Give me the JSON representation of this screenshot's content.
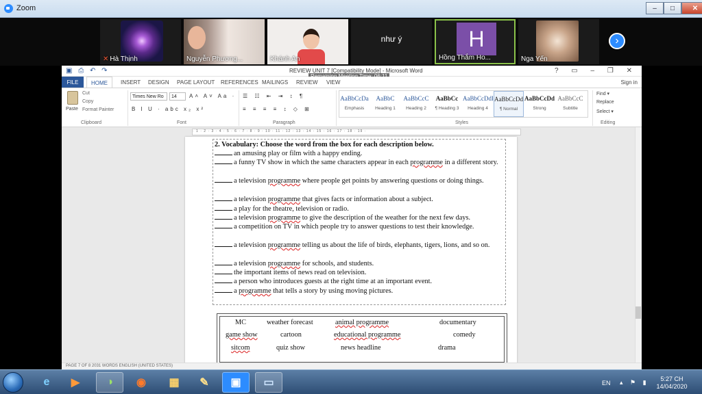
{
  "zoom": {
    "title": "Zoom",
    "window_buttons": [
      "–",
      "□",
      "✕"
    ],
    "participants": [
      {
        "name": "Hà Thịnh",
        "muted": true
      },
      {
        "name": "Nguyễn Phương...",
        "muted": false
      },
      {
        "name": "Khánh An",
        "muted": false
      },
      {
        "name": "như ý",
        "muted": false
      },
      {
        "name": "Hồng Thắm Ho...",
        "avatar_letter": "H",
        "active_speaker": true,
        "muted": false
      },
      {
        "name": "Nga Yến",
        "muted": false
      }
    ],
    "next_arrow": "›"
  },
  "word": {
    "quick_access": "▣ ⎙ ↶ ↷",
    "document_title": "REVIEW UNIT 7 [Compatibility Mode] - Microsoft Word",
    "meeting_time": "Remaining Meeting Time: 06:11",
    "title_controls": "? ▭ – ❐ ✕",
    "tabs": [
      "FILE",
      "HOME",
      "INSERT",
      "DESIGN",
      "PAGE LAYOUT",
      "REFERENCES",
      "MAILINGS",
      "REVIEW",
      "VIEW"
    ],
    "signin": "Sign in",
    "ribbon": {
      "paste": "Paste",
      "cut": "Cut",
      "copy": "Copy",
      "format_painter": "Format Painter",
      "clipboard": "Clipboard",
      "font_name": "Times New Ro",
      "font_size": "14",
      "font_btns": "B I U · abc x₂ x²",
      "font_btns2": "A˄ A˅ Aa ·",
      "font": "Font",
      "para_btns": "☰ ☷ ⇤ ⇥ ↕ ¶",
      "para_btns2": "≡ ≡ ≡ ≡ ↕ ◇ ⊞",
      "paragraph": "Paragraph",
      "styles": [
        {
          "sample": "AaBbCcDa",
          "name": "Emphasis"
        },
        {
          "sample": "AaBbC",
          "name": "Heading 1"
        },
        {
          "sample": "AaBbCcC",
          "name": "Heading 2"
        },
        {
          "sample": "AaBbCc",
          "name": "¶ Heading 3"
        },
        {
          "sample": "AaBbCcDdI",
          "name": "Heading 4"
        },
        {
          "sample": "AaBbCcDdI",
          "name": "¶ Normal"
        },
        {
          "sample": "AaBbCcDd",
          "name": "Strong"
        },
        {
          "sample": "AaBbCcC",
          "name": "Subtitle"
        }
      ],
      "styles_label": "Styles",
      "find": "Find ▾",
      "replace": "Replace",
      "select": "Select ▾",
      "editing": "Editing"
    },
    "ruler": "· 1 · 2 · 3 · 4 · 5 · 6 · 7 · 8 · 9 · 10 · 11 · 12 · 13 · 14 · 15 · 16 · 17 · 18 · 19 ·",
    "doc": {
      "heading": "2. Vocabulary: Choose the word from the box for each description below.",
      "items": [
        {
          "pre": "",
          "squig": "",
          "text": "an amusing play or film with a happy ending."
        },
        {
          "pre": "a funny TV show in which the same characters appear in each ",
          "squig": "programme",
          "text": " in a different story."
        },
        {
          "pre": "a television ",
          "squig": "programme",
          "text": " where people get points by answering questions or doing things."
        },
        {
          "pre": "a television ",
          "squig": "programme",
          "text": " that gives facts or information about a subject."
        },
        {
          "pre": "",
          "squig": "",
          "text": "a play for the theatre, television or radio."
        },
        {
          "pre": "a television ",
          "squig": "programme",
          "text": " to give the description of the weather for the next few days."
        },
        {
          "pre": "",
          "squig": "",
          "text": "a competition on TV in which people try to answer questions to test their knowledge."
        },
        {
          "pre": "a television ",
          "squig": "programme",
          "text": " telling us about the life of birds, elephants, tigers, lions, and so on."
        },
        {
          "pre": "a television ",
          "squig": "programme",
          "text": " for schools, and students."
        },
        {
          "pre": "",
          "squig": "",
          "text": "the important items of news read on television."
        },
        {
          "pre": "",
          "squig": "",
          "text": "a person who introduces guests at the right time at an important event."
        },
        {
          "pre": "a ",
          "squig": "programme",
          "text": " that tells a story by using moving pictures."
        }
      ]
    },
    "word_box": {
      "row1": [
        "MC",
        "weather forecast",
        "animal programme",
        "documentary"
      ],
      "row2": [
        "game show",
        "cartoon",
        "educational programme",
        "comedy"
      ],
      "row3": [
        "sitcom",
        "quiz show",
        "news headline",
        "drama"
      ]
    },
    "status": "PAGE 7 OF 8    2031 WORDS    ENGLISH (UNITED STATES)"
  },
  "taskbar": {
    "apps": [
      "e",
      "▶",
      "◑",
      "◉",
      "▦",
      "✎",
      "▣",
      "▭"
    ],
    "lang": "EN",
    "tray": "▴ ⚑ ▮",
    "time": "5:27 CH",
    "date": "14/04/2020"
  }
}
